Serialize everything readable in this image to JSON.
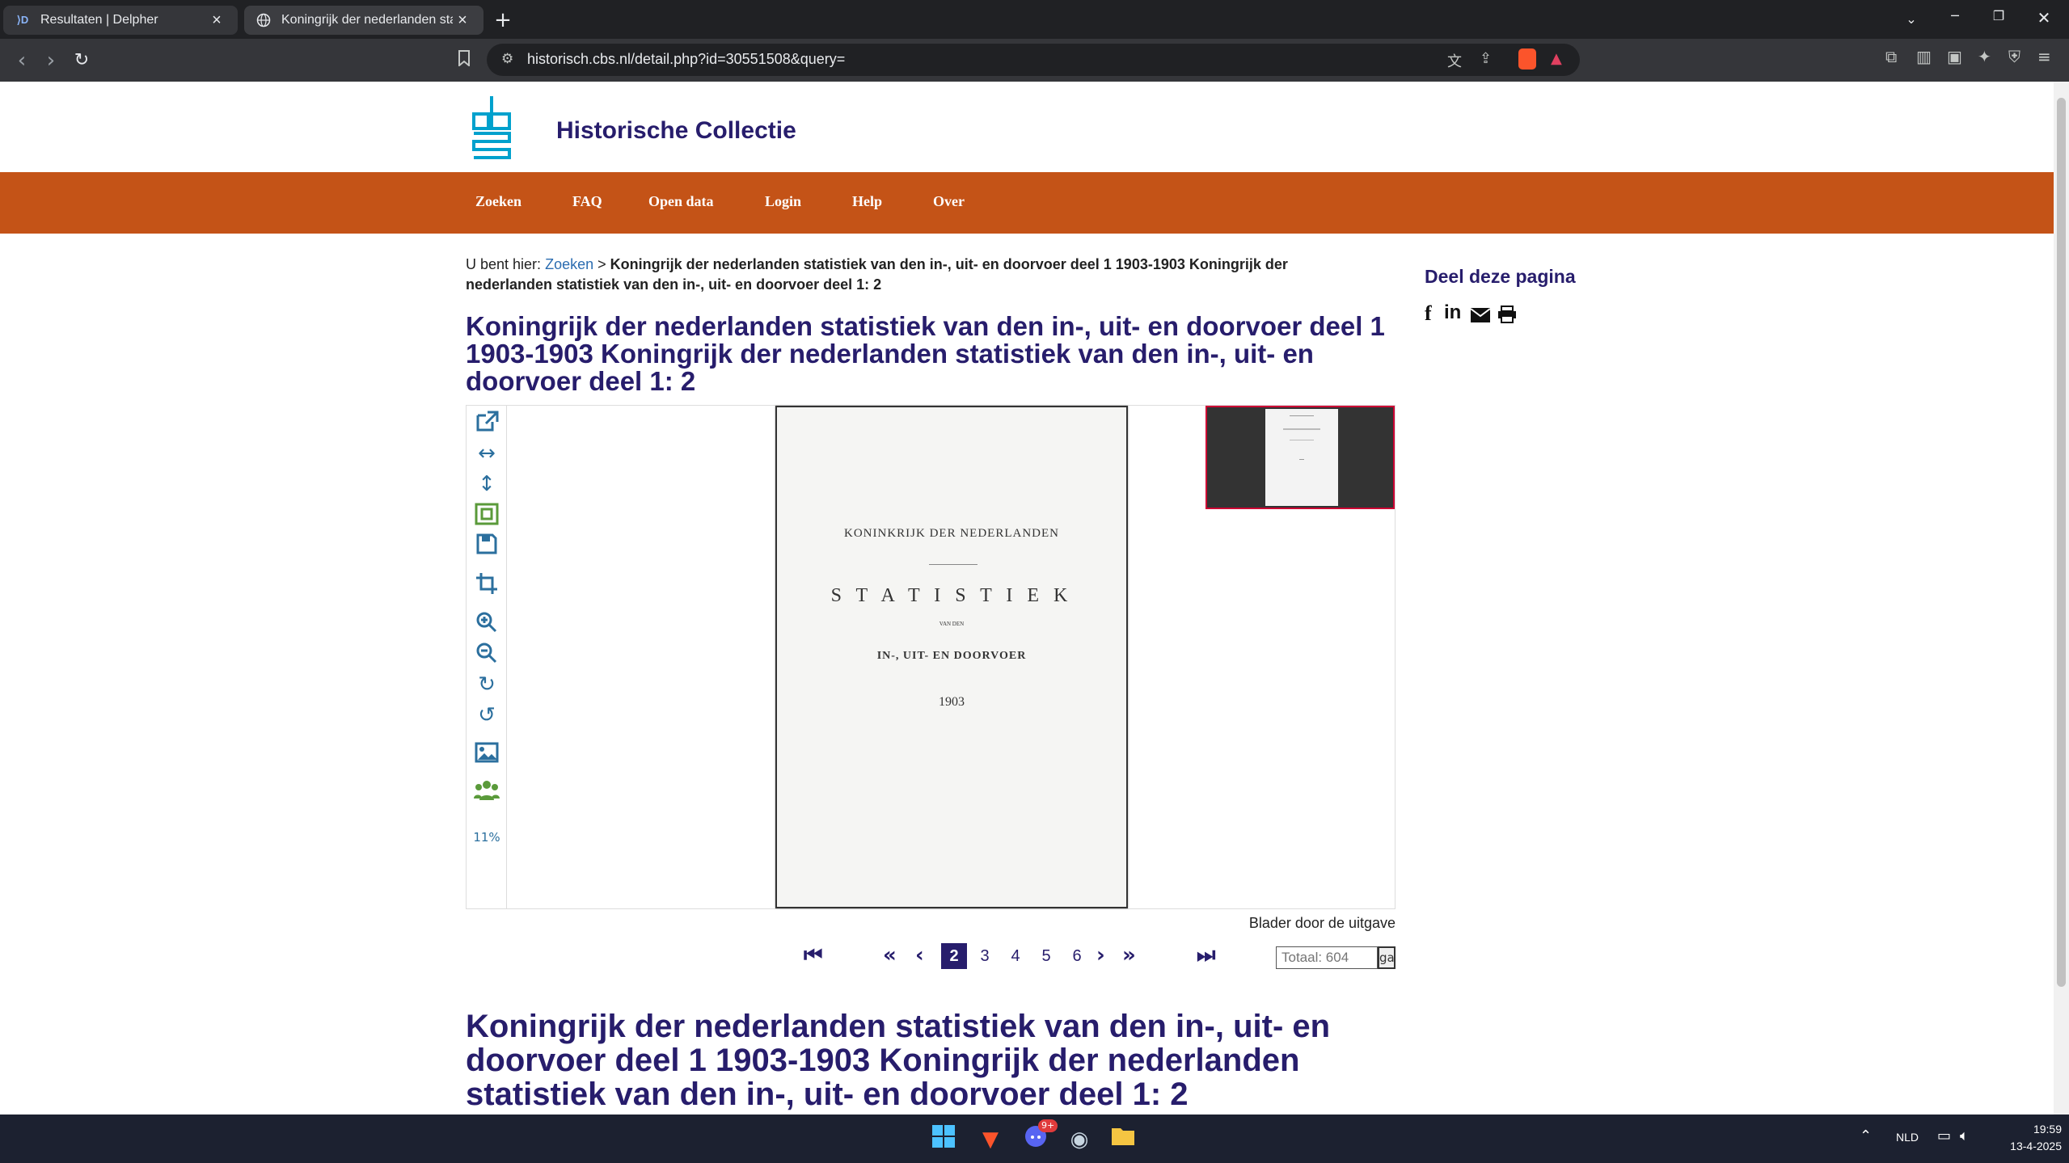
{
  "browser": {
    "tabs": [
      {
        "title": "Resultaten | Delpher",
        "favicon": "delpher-icon"
      },
      {
        "title": "Koningrijk der nederlanden stati",
        "favicon": "globe-icon"
      }
    ],
    "url": "historisch.cbs.nl/detail.php?id=30551508&query="
  },
  "site": {
    "title": "Historische Collectie",
    "nav": [
      "Zoeken",
      "FAQ",
      "Open data",
      "Login",
      "Help",
      "Over"
    ]
  },
  "breadcrumb": {
    "prefix": "U bent hier:",
    "link": "Zoeken",
    "separator": ">",
    "current": "Koningrijk der nederlanden statistiek van den in-, uit- en doorvoer deel 1 1903-1903 Koningrijk der nederlanden statistiek van den in-, uit- en doorvoer deel 1: 2"
  },
  "heading": "Koningrijk der nederlanden statistiek van den in-, uit- en doorvoer deel 1 1903-1903 Koningrijk der nederlanden statistiek van den in-, uit- en doorvoer deel 1: 2",
  "viewer": {
    "zoom": "11%",
    "document": {
      "line1": "KONINKRIJK DER NEDERLANDEN",
      "line2": "S T A T I S T I E K",
      "line3": "VAN DEN",
      "line4": "IN-, UIT- EN DOORVOER",
      "line5": "1903"
    }
  },
  "pager": {
    "caption": "Blader door de uitgave",
    "pages": [
      "2",
      "3",
      "4",
      "5",
      "6"
    ],
    "active": "2",
    "total_placeholder": "Totaal: 604",
    "go_label": "ga"
  },
  "heading2": "Koningrijk der nederlanden statistiek van den in-, uit- en doorvoer deel 1 1903-1903 Koningrijk der nederlanden statistiek van den in-, uit- en doorvoer deel 1: 2",
  "share": {
    "title": "Deel deze pagina",
    "icons": [
      "facebook-icon",
      "linkedin-icon",
      "email-icon",
      "print-icon"
    ]
  },
  "taskbar": {
    "lang": "NLD",
    "time": "19:59",
    "date": "13-4-2025",
    "discord_badge": "9+"
  }
}
